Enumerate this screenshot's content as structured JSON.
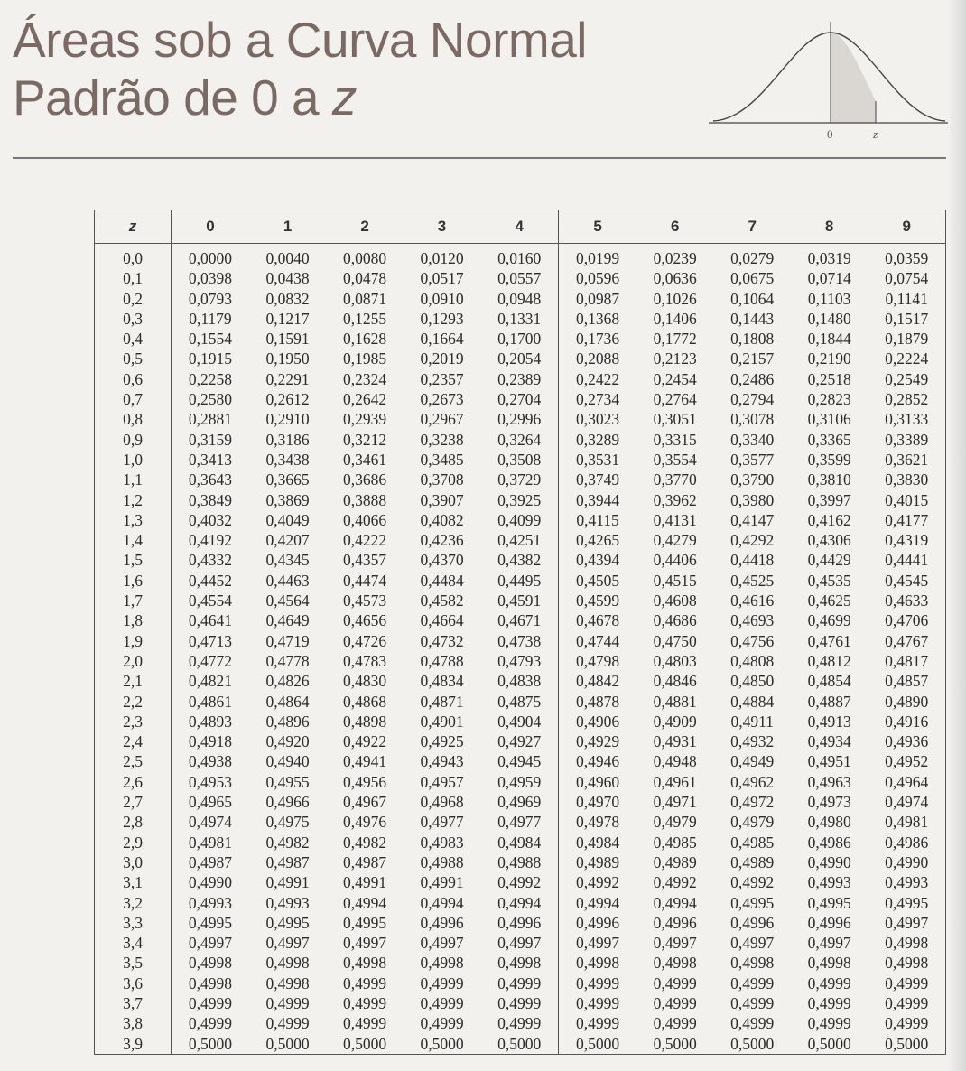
{
  "title": {
    "line1": "Áreas sob a Curva Normal",
    "line2_prefix": "Padrão de 0 a ",
    "line2_var": "z"
  },
  "figure": {
    "label_zero": "0",
    "label_z": "z"
  },
  "table": {
    "headers": [
      "z",
      "0",
      "1",
      "2",
      "3",
      "4",
      "5",
      "6",
      "7",
      "8",
      "9"
    ],
    "rows": [
      [
        "0,0",
        "0,0000",
        "0,0040",
        "0,0080",
        "0,0120",
        "0,0160",
        "0,0199",
        "0,0239",
        "0,0279",
        "0,0319",
        "0,0359"
      ],
      [
        "0,1",
        "0,0398",
        "0,0438",
        "0,0478",
        "0,0517",
        "0,0557",
        "0,0596",
        "0,0636",
        "0,0675",
        "0,0714",
        "0,0754"
      ],
      [
        "0,2",
        "0,0793",
        "0,0832",
        "0,0871",
        "0,0910",
        "0,0948",
        "0,0987",
        "0,1026",
        "0,1064",
        "0,1103",
        "0,1141"
      ],
      [
        "0,3",
        "0,1179",
        "0,1217",
        "0,1255",
        "0,1293",
        "0,1331",
        "0,1368",
        "0,1406",
        "0,1443",
        "0,1480",
        "0,1517"
      ],
      [
        "0,4",
        "0,1554",
        "0,1591",
        "0,1628",
        "0,1664",
        "0,1700",
        "0,1736",
        "0,1772",
        "0,1808",
        "0,1844",
        "0,1879"
      ],
      [
        "0,5",
        "0,1915",
        "0,1950",
        "0,1985",
        "0,2019",
        "0,2054",
        "0,2088",
        "0,2123",
        "0,2157",
        "0,2190",
        "0,2224"
      ],
      [
        "0,6",
        "0,2258",
        "0,2291",
        "0,2324",
        "0,2357",
        "0,2389",
        "0,2422",
        "0,2454",
        "0,2486",
        "0,2518",
        "0,2549"
      ],
      [
        "0,7",
        "0,2580",
        "0,2612",
        "0,2642",
        "0,2673",
        "0,2704",
        "0,2734",
        "0,2764",
        "0,2794",
        "0,2823",
        "0,2852"
      ],
      [
        "0,8",
        "0,2881",
        "0,2910",
        "0,2939",
        "0,2967",
        "0,2996",
        "0,3023",
        "0,3051",
        "0,3078",
        "0,3106",
        "0,3133"
      ],
      [
        "0,9",
        "0,3159",
        "0,3186",
        "0,3212",
        "0,3238",
        "0,3264",
        "0,3289",
        "0,3315",
        "0,3340",
        "0,3365",
        "0,3389"
      ],
      [
        "1,0",
        "0,3413",
        "0,3438",
        "0,3461",
        "0,3485",
        "0,3508",
        "0,3531",
        "0,3554",
        "0,3577",
        "0,3599",
        "0,3621"
      ],
      [
        "1,1",
        "0,3643",
        "0,3665",
        "0,3686",
        "0,3708",
        "0,3729",
        "0,3749",
        "0,3770",
        "0,3790",
        "0,3810",
        "0,3830"
      ],
      [
        "1,2",
        "0,3849",
        "0,3869",
        "0,3888",
        "0,3907",
        "0,3925",
        "0,3944",
        "0,3962",
        "0,3980",
        "0,3997",
        "0,4015"
      ],
      [
        "1,3",
        "0,4032",
        "0,4049",
        "0,4066",
        "0,4082",
        "0,4099",
        "0,4115",
        "0,4131",
        "0,4147",
        "0,4162",
        "0,4177"
      ],
      [
        "1,4",
        "0,4192",
        "0,4207",
        "0,4222",
        "0,4236",
        "0,4251",
        "0,4265",
        "0,4279",
        "0,4292",
        "0,4306",
        "0,4319"
      ],
      [
        "1,5",
        "0,4332",
        "0,4345",
        "0,4357",
        "0,4370",
        "0,4382",
        "0,4394",
        "0,4406",
        "0,4418",
        "0,4429",
        "0,4441"
      ],
      [
        "1,6",
        "0,4452",
        "0,4463",
        "0,4474",
        "0,4484",
        "0,4495",
        "0,4505",
        "0,4515",
        "0,4525",
        "0,4535",
        "0,4545"
      ],
      [
        "1,7",
        "0,4554",
        "0,4564",
        "0,4573",
        "0,4582",
        "0,4591",
        "0,4599",
        "0,4608",
        "0,4616",
        "0,4625",
        "0,4633"
      ],
      [
        "1,8",
        "0,4641",
        "0,4649",
        "0,4656",
        "0,4664",
        "0,4671",
        "0,4678",
        "0,4686",
        "0,4693",
        "0,4699",
        "0,4706"
      ],
      [
        "1,9",
        "0,4713",
        "0,4719",
        "0,4726",
        "0,4732",
        "0,4738",
        "0,4744",
        "0,4750",
        "0,4756",
        "0,4761",
        "0,4767"
      ],
      [
        "2,0",
        "0,4772",
        "0,4778",
        "0,4783",
        "0,4788",
        "0,4793",
        "0,4798",
        "0,4803",
        "0,4808",
        "0,4812",
        "0,4817"
      ],
      [
        "2,1",
        "0,4821",
        "0,4826",
        "0,4830",
        "0,4834",
        "0,4838",
        "0,4842",
        "0,4846",
        "0,4850",
        "0,4854",
        "0,4857"
      ],
      [
        "2,2",
        "0,4861",
        "0,4864",
        "0,4868",
        "0,4871",
        "0,4875",
        "0,4878",
        "0,4881",
        "0,4884",
        "0,4887",
        "0,4890"
      ],
      [
        "2,3",
        "0,4893",
        "0,4896",
        "0,4898",
        "0,4901",
        "0,4904",
        "0,4906",
        "0,4909",
        "0,4911",
        "0,4913",
        "0,4916"
      ],
      [
        "2,4",
        "0,4918",
        "0,4920",
        "0,4922",
        "0,4925",
        "0,4927",
        "0,4929",
        "0,4931",
        "0,4932",
        "0,4934",
        "0,4936"
      ],
      [
        "2,5",
        "0,4938",
        "0,4940",
        "0,4941",
        "0,4943",
        "0,4945",
        "0,4946",
        "0,4948",
        "0,4949",
        "0,4951",
        "0,4952"
      ],
      [
        "2,6",
        "0,4953",
        "0,4955",
        "0,4956",
        "0,4957",
        "0,4959",
        "0,4960",
        "0,4961",
        "0,4962",
        "0,4963",
        "0,4964"
      ],
      [
        "2,7",
        "0,4965",
        "0,4966",
        "0,4967",
        "0,4968",
        "0,4969",
        "0,4970",
        "0,4971",
        "0,4972",
        "0,4973",
        "0,4974"
      ],
      [
        "2,8",
        "0,4974",
        "0,4975",
        "0,4976",
        "0,4977",
        "0,4977",
        "0,4978",
        "0,4979",
        "0,4979",
        "0,4980",
        "0,4981"
      ],
      [
        "2,9",
        "0,4981",
        "0,4982",
        "0,4982",
        "0,4983",
        "0,4984",
        "0,4984",
        "0,4985",
        "0,4985",
        "0,4986",
        "0,4986"
      ],
      [
        "3,0",
        "0,4987",
        "0,4987",
        "0,4987",
        "0,4988",
        "0,4988",
        "0,4989",
        "0,4989",
        "0,4989",
        "0,4990",
        "0,4990"
      ],
      [
        "3,1",
        "0,4990",
        "0,4991",
        "0,4991",
        "0,4991",
        "0,4992",
        "0,4992",
        "0,4992",
        "0,4992",
        "0,4993",
        "0,4993"
      ],
      [
        "3,2",
        "0,4993",
        "0,4993",
        "0,4994",
        "0,4994",
        "0,4994",
        "0,4994",
        "0,4994",
        "0,4995",
        "0,4995",
        "0,4995"
      ],
      [
        "3,3",
        "0,4995",
        "0,4995",
        "0,4995",
        "0,4996",
        "0,4996",
        "0,4996",
        "0,4996",
        "0,4996",
        "0,4996",
        "0,4997"
      ],
      [
        "3,4",
        "0,4997",
        "0,4997",
        "0,4997",
        "0,4997",
        "0,4997",
        "0,4997",
        "0,4997",
        "0,4997",
        "0,4997",
        "0,4998"
      ],
      [
        "3,5",
        "0,4998",
        "0,4998",
        "0,4998",
        "0,4998",
        "0,4998",
        "0,4998",
        "0,4998",
        "0,4998",
        "0,4998",
        "0,4998"
      ],
      [
        "3,6",
        "0,4998",
        "0,4998",
        "0,4999",
        "0,4999",
        "0,4999",
        "0,4999",
        "0,4999",
        "0,4999",
        "0,4999",
        "0,4999"
      ],
      [
        "3,7",
        "0,4999",
        "0,4999",
        "0,4999",
        "0,4999",
        "0,4999",
        "0,4999",
        "0,4999",
        "0,4999",
        "0,4999",
        "0,4999"
      ],
      [
        "3,8",
        "0,4999",
        "0,4999",
        "0,4999",
        "0,4999",
        "0,4999",
        "0,4999",
        "0,4999",
        "0,4999",
        "0,4999",
        "0,4999"
      ],
      [
        "3,9",
        "0,5000",
        "0,5000",
        "0,5000",
        "0,5000",
        "0,5000",
        "0,5000",
        "0,5000",
        "0,5000",
        "0,5000",
        "0,5000"
      ]
    ]
  },
  "colors": {
    "title": "#7a6a63",
    "shade": "#dad6d2",
    "rule": "#777777"
  }
}
